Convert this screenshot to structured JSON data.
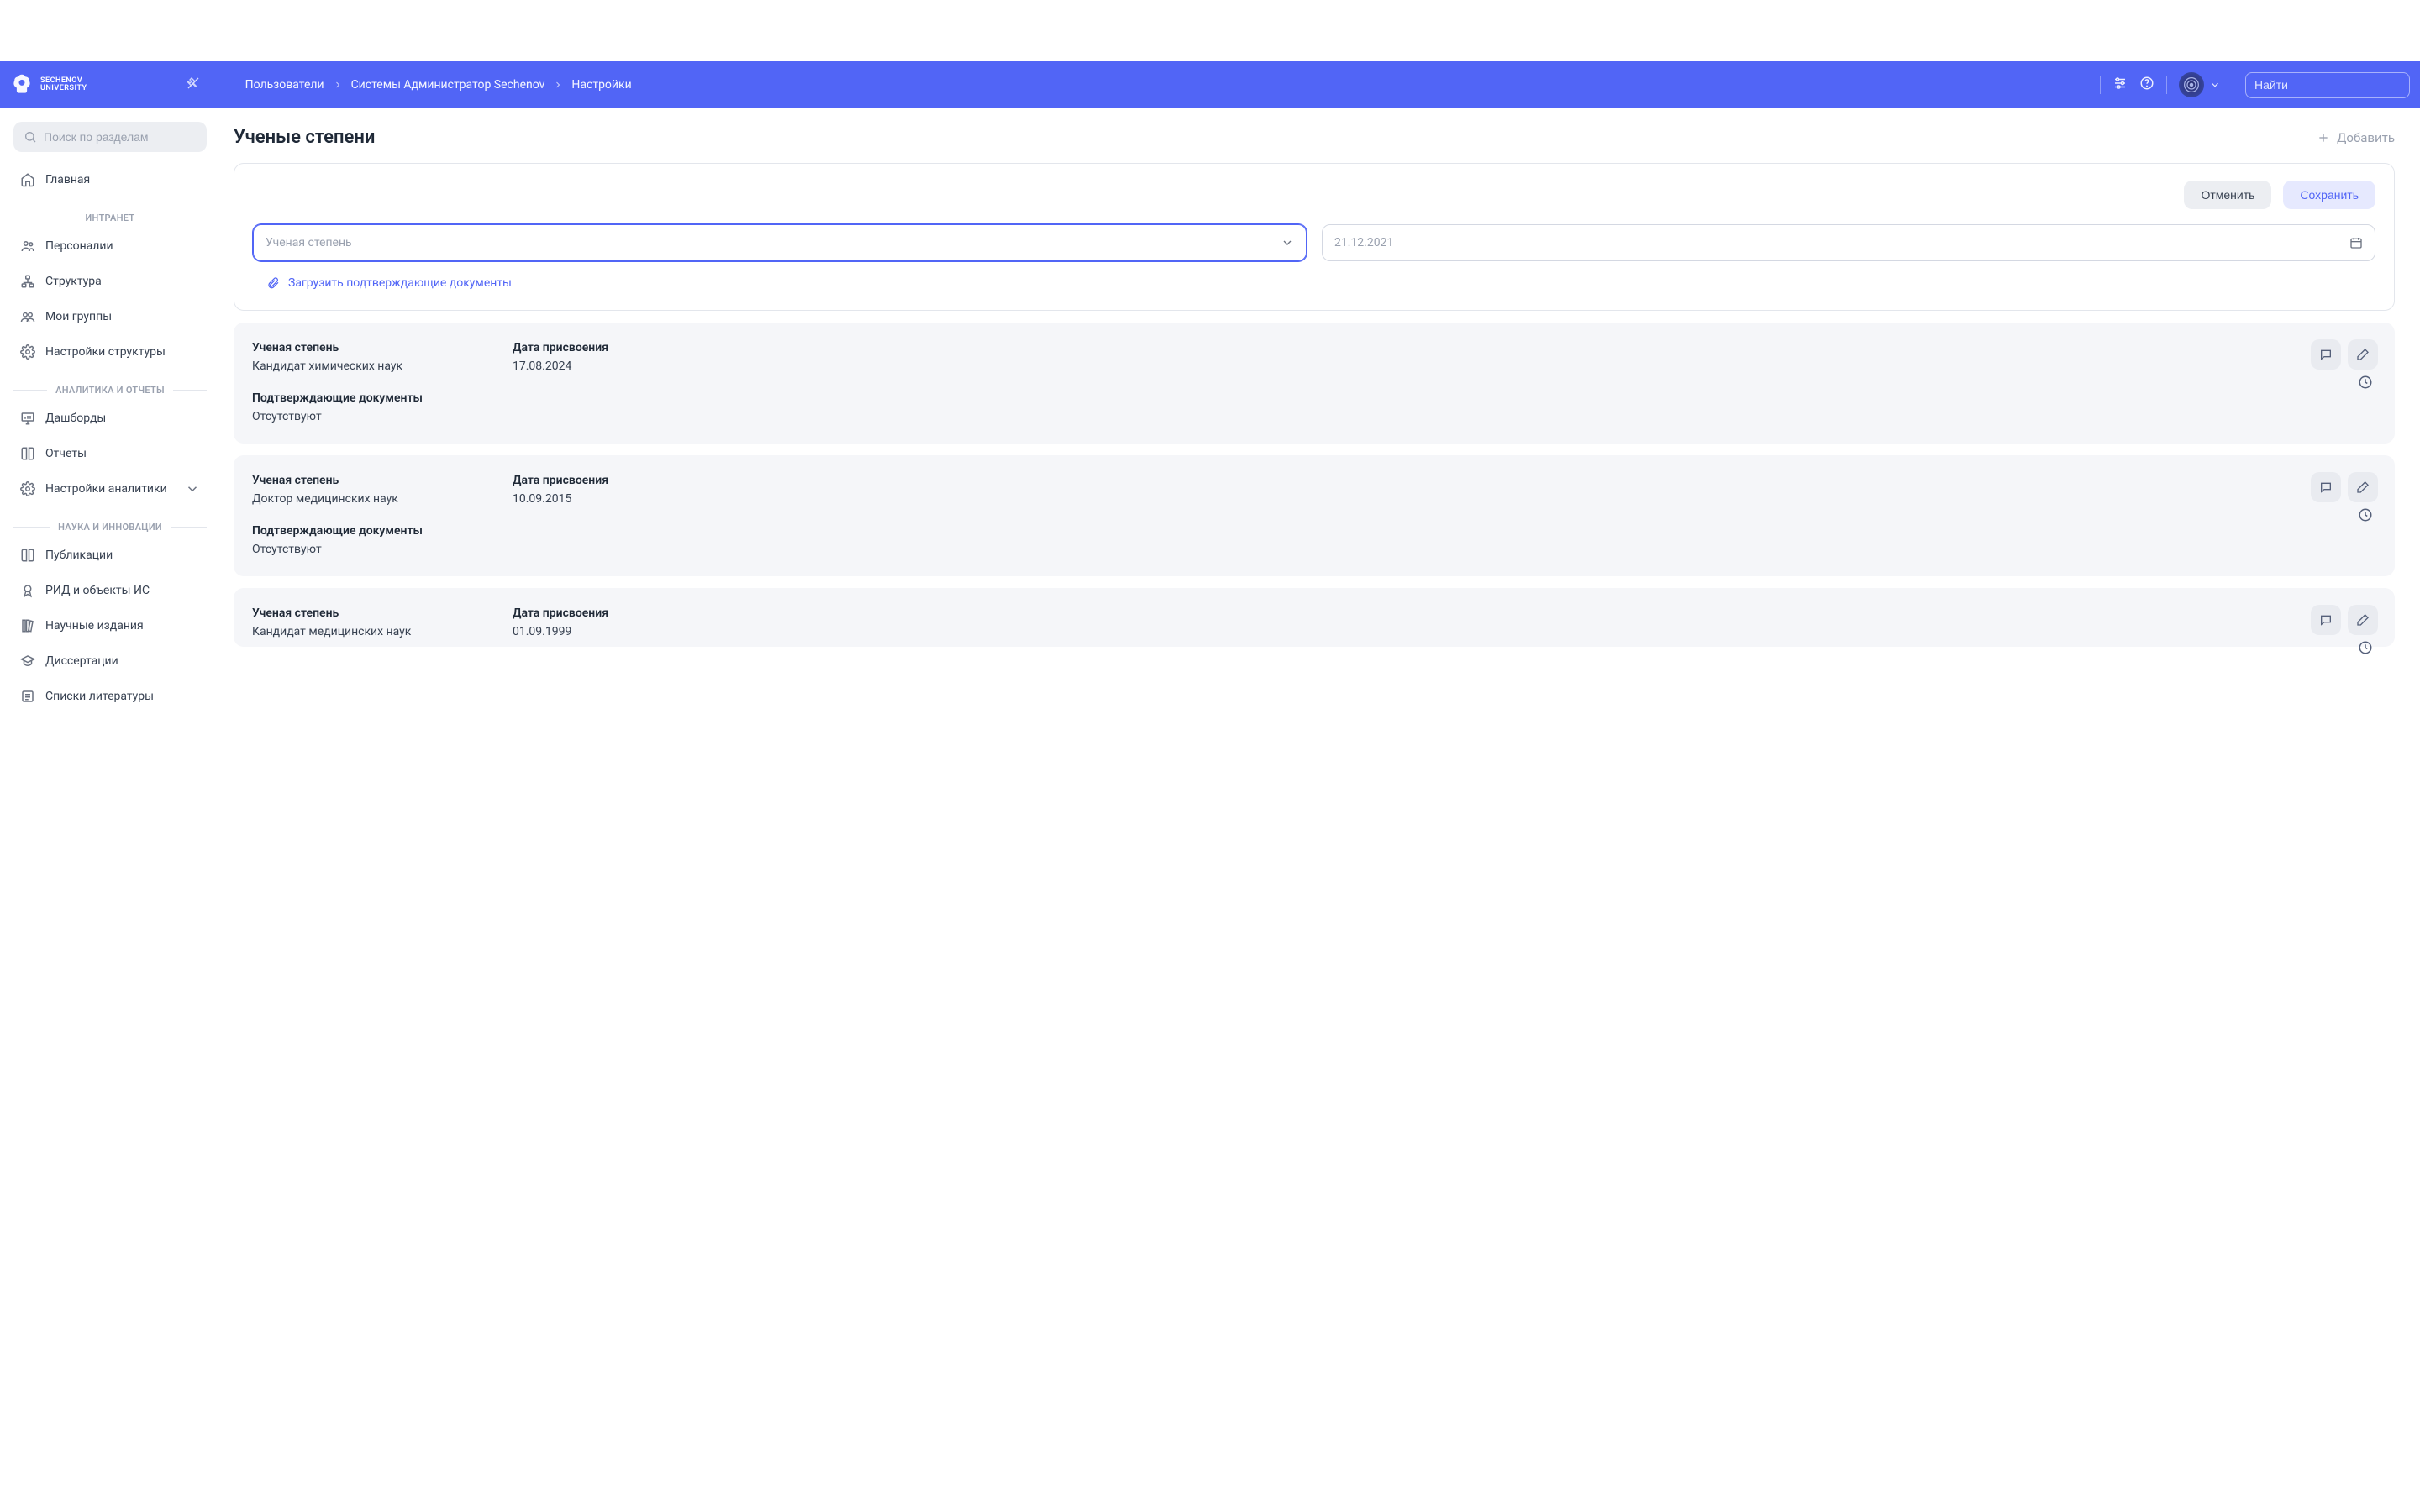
{
  "brand": {
    "line1": "SECHENOV",
    "line2": "UNIVERSITY"
  },
  "breadcrumbs": {
    "a": "Пользователи",
    "b": "Системы Администратор Sechenov",
    "c": "Настройки"
  },
  "search_top_placeholder": "Найти",
  "sidebar": {
    "search_placeholder": "Поиск по разделам",
    "home": "Главная",
    "grp_intranet": "ИНТРАНЕТ",
    "personnel": "Персоналии",
    "structure": "Структура",
    "groups": "Мои группы",
    "struct_settings": "Настройки структуры",
    "grp_analytics": "АНАЛИТИКА И ОТЧЕТЫ",
    "dashboards": "Дашборды",
    "reports": "Отчеты",
    "analytics_settings": "Настройки аналитики",
    "grp_science": "НАУКА И ИННОВАЦИИ",
    "pubs": "Публикации",
    "rid": "РИД и объекты ИС",
    "sci_editions": "Научные издания",
    "dissertations": "Диссертации",
    "bibliography": "Списки литературы"
  },
  "page": {
    "title": "Ученые степени",
    "add": "Добавить",
    "cancel": "Отменить",
    "save": "Сохранить",
    "degree_placeholder": "Ученая степень",
    "date_placeholder": "21.12.2021",
    "upload": "Загрузить подтверждающие документы",
    "labels": {
      "degree": "Ученая степень",
      "date": "Дата присвоения",
      "docs": "Подтверждающие документы",
      "docs_none": "Отсутствуют"
    }
  },
  "cards": [
    {
      "degree": "Кандидат химических наук",
      "date": "17.08.2024"
    },
    {
      "degree": "Доктор медицинских наук",
      "date": "10.09.2015"
    },
    {
      "degree": "Кандидат медицинских наук",
      "date": "01.09.1999"
    }
  ]
}
